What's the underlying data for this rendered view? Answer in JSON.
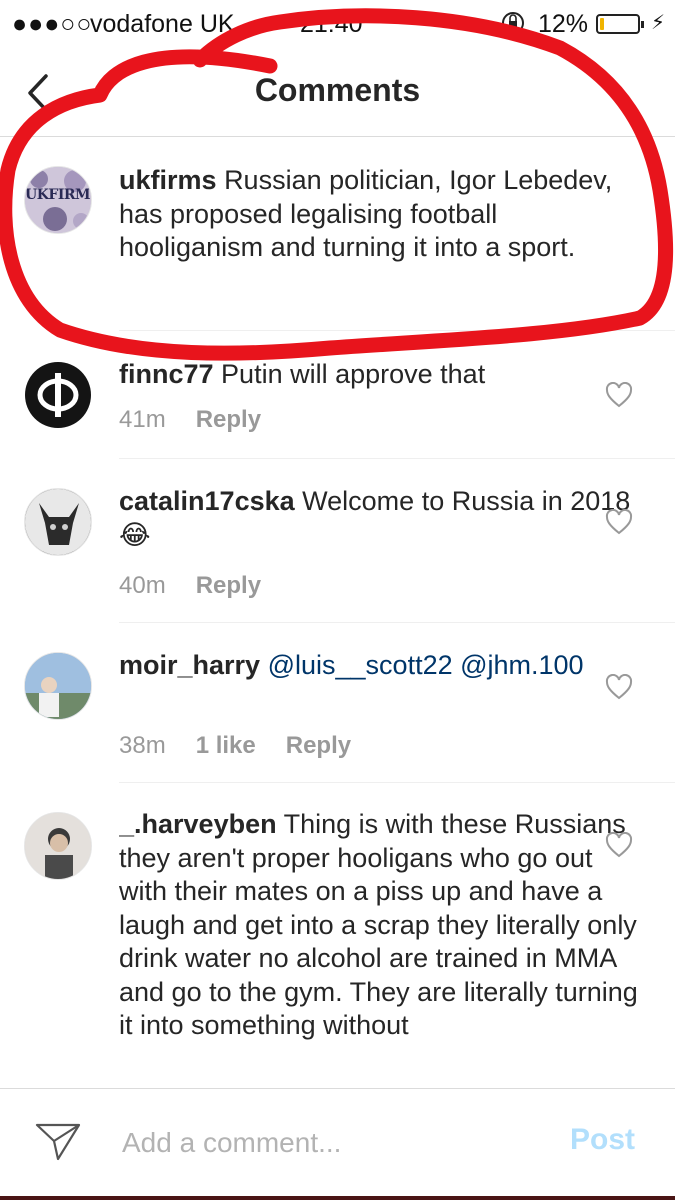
{
  "status_bar": {
    "signal": "●●●○○",
    "carrier": "vodafone UK",
    "time": "21:40",
    "battery_percent": "12%",
    "battery_level": 0.12
  },
  "nav": {
    "title": "Comments",
    "back_icon": "chevron-left-icon"
  },
  "caption": {
    "username": "ukfirms",
    "text": "Russian politician, Igor Lebedev, has proposed legalising football hooliganism and turning it into a sport.",
    "avatar_text": "UKFIRMS"
  },
  "comments": [
    {
      "username": "finnc77",
      "text": "Putin will approve that",
      "time": "41m",
      "likes": "",
      "reply": "Reply"
    },
    {
      "username": "catalin17cska",
      "text": "Welcome to Russia in 2018😂",
      "time": "40m",
      "likes": "",
      "reply": "Reply"
    },
    {
      "username": "moir_harry",
      "text": "@luis__scott22 @jhm.100",
      "time": "38m",
      "likes": "1 like",
      "reply": "Reply"
    },
    {
      "username": "_.harveyben",
      "text": "Thing is with these Russians they aren't proper hooligans who go out with their mates on a piss up and have a laugh and get into a scrap they literally only drink water no alcohol are trained in MMA and go to the gym. They are literally turning it into something without",
      "time": "",
      "likes": "",
      "reply": ""
    }
  ],
  "comment_bar": {
    "placeholder": "Add a comment...",
    "post_label": "Post",
    "send_icon": "send-icon"
  },
  "colors": {
    "annotation": "#e8141c",
    "mention": "#003569",
    "post_disabled": "#b2dffc",
    "meta": "#999999"
  }
}
